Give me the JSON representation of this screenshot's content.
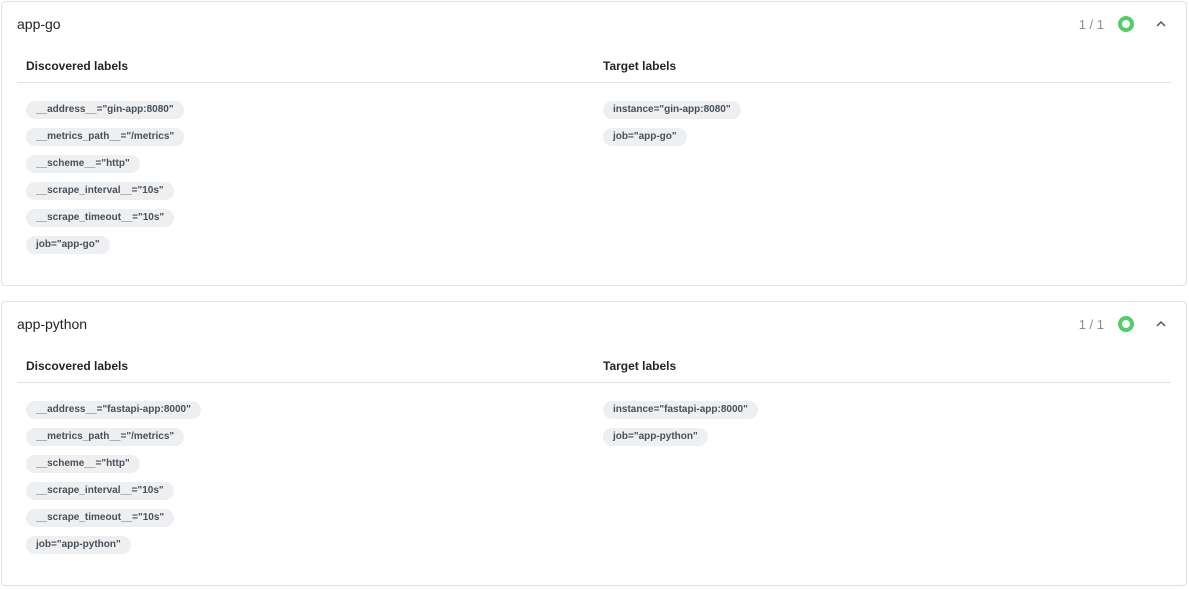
{
  "pools": [
    {
      "name": "app-go",
      "count": "1 / 1",
      "status_color": "#51cf66",
      "collapse_icon": "chevron-up-icon",
      "discovered_header": "Discovered labels",
      "target_header": "Target labels",
      "discovered_labels": [
        "__address__=\"gin-app:8080\"",
        "__metrics_path__=\"/metrics\"",
        "__scheme__=\"http\"",
        "__scrape_interval__=\"10s\"",
        "__scrape_timeout__=\"10s\"",
        "job=\"app-go\""
      ],
      "target_labels": [
        "instance=\"gin-app:8080\"",
        "job=\"app-go\""
      ]
    },
    {
      "name": "app-python",
      "count": "1 / 1",
      "status_color": "#51cf66",
      "collapse_icon": "chevron-up-icon",
      "discovered_header": "Discovered labels",
      "target_header": "Target labels",
      "discovered_labels": [
        "__address__=\"fastapi-app:8000\"",
        "__metrics_path__=\"/metrics\"",
        "__scheme__=\"http\"",
        "__scrape_interval__=\"10s\"",
        "__scrape_timeout__=\"10s\"",
        "job=\"app-python\""
      ],
      "target_labels": [
        "instance=\"fastapi-app:8000\"",
        "job=\"app-python\""
      ]
    }
  ]
}
